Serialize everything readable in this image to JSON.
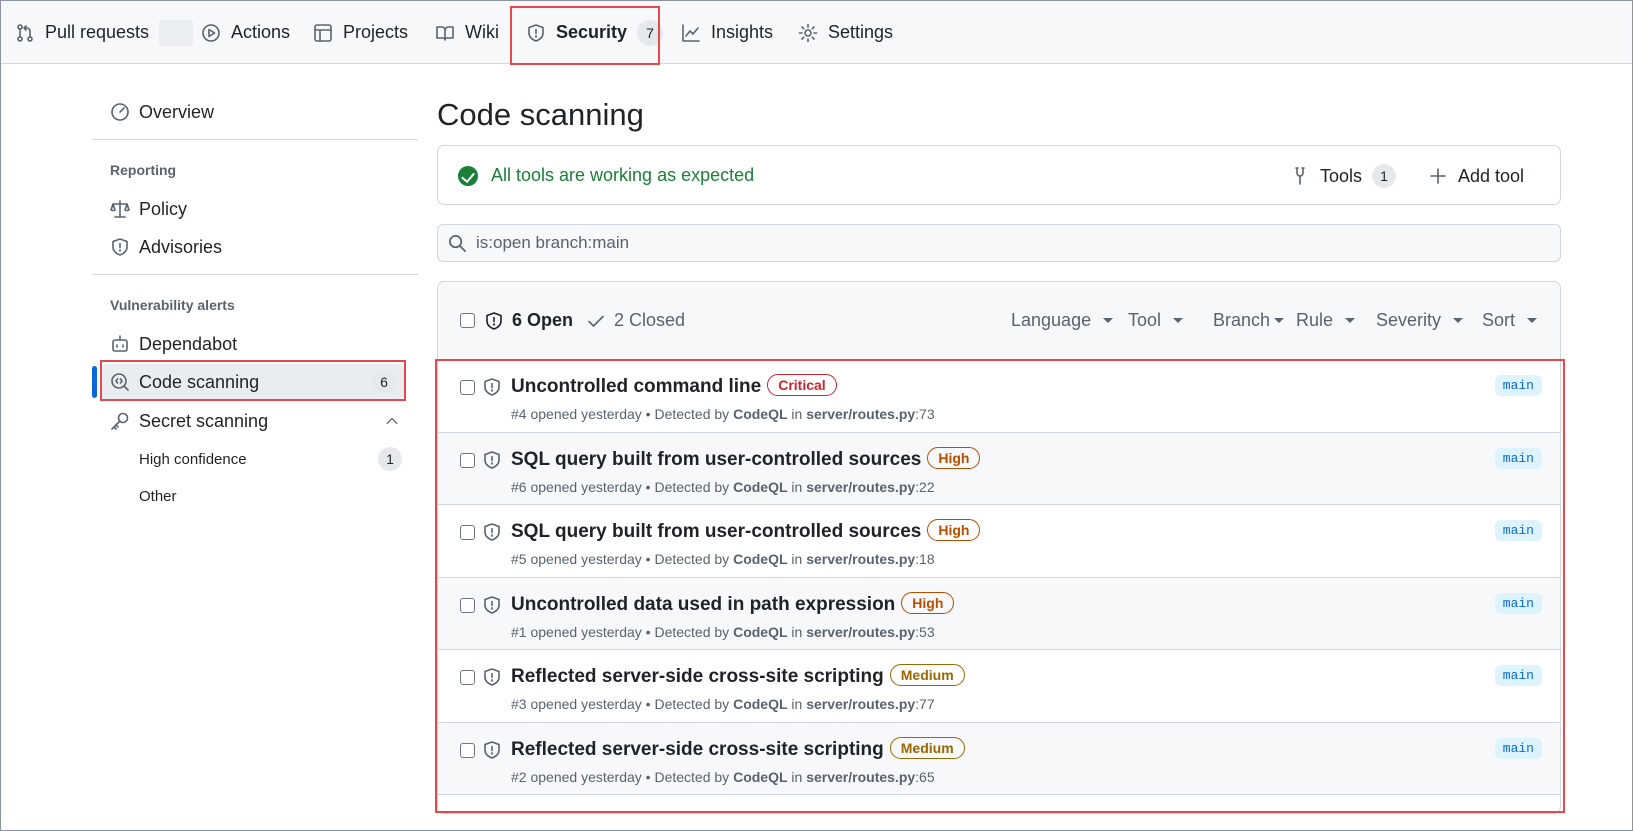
{
  "topnav": {
    "tabs": [
      {
        "label": "Pull requests",
        "icon": "git-pull-request-icon"
      },
      {
        "label": "Actions",
        "icon": "play-icon"
      },
      {
        "label": "Projects",
        "icon": "table-icon"
      },
      {
        "label": "Wiki",
        "icon": "book-icon"
      },
      {
        "label": "Security",
        "icon": "shield-icon",
        "count": "7",
        "selected": true
      },
      {
        "label": "Insights",
        "icon": "graph-icon"
      },
      {
        "label": "Settings",
        "icon": "gear-icon"
      }
    ]
  },
  "sidebar": {
    "overview": "Overview",
    "reporting_heading": "Reporting",
    "policy": "Policy",
    "advisories": "Advisories",
    "vuln_heading": "Vulnerability alerts",
    "dependabot": "Dependabot",
    "code_scanning": "Code scanning",
    "code_scanning_count": "6",
    "secret_scanning": "Secret scanning",
    "high_confidence": "High confidence",
    "high_confidence_count": "1",
    "other": "Other"
  },
  "main": {
    "title": "Code scanning",
    "status_text": "All tools are working as expected",
    "tools_label": "Tools",
    "tools_count": "1",
    "add_tool_label": "Add tool",
    "search_value": "is:open branch:main",
    "open_label": "6 Open",
    "closed_label": "2 Closed",
    "filters": [
      "Language",
      "Tool",
      "Branch",
      "Rule",
      "Severity",
      "Sort"
    ]
  },
  "alerts": [
    {
      "title": "Uncontrolled command line",
      "severity": "Critical",
      "sev_class": "critical",
      "number": "#4",
      "opened": "opened yesterday",
      "detected_by_label": "Detected by",
      "tool": "CodeQL",
      "in_label": "in",
      "path": "server/routes.py",
      "line": ":73",
      "branch": "main"
    },
    {
      "title": "SQL query built from user-controlled sources",
      "severity": "High",
      "sev_class": "high",
      "number": "#6",
      "opened": "opened yesterday",
      "detected_by_label": "Detected by",
      "tool": "CodeQL",
      "in_label": "in",
      "path": "server/routes.py",
      "line": ":22",
      "branch": "main"
    },
    {
      "title": "SQL query built from user-controlled sources",
      "severity": "High",
      "sev_class": "high",
      "number": "#5",
      "opened": "opened yesterday",
      "detected_by_label": "Detected by",
      "tool": "CodeQL",
      "in_label": "in",
      "path": "server/routes.py",
      "line": ":18",
      "branch": "main"
    },
    {
      "title": "Uncontrolled data used in path expression",
      "severity": "High",
      "sev_class": "high",
      "number": "#1",
      "opened": "opened yesterday",
      "detected_by_label": "Detected by",
      "tool": "CodeQL",
      "in_label": "in",
      "path": "server/routes.py",
      "line": ":53",
      "branch": "main"
    },
    {
      "title": "Reflected server-side cross-site scripting",
      "severity": "Medium",
      "sev_class": "medium",
      "number": "#3",
      "opened": "opened yesterday",
      "detected_by_label": "Detected by",
      "tool": "CodeQL",
      "in_label": "in",
      "path": "server/routes.py",
      "line": ":77",
      "branch": "main"
    },
    {
      "title": "Reflected server-side cross-site scripting",
      "severity": "Medium",
      "sev_class": "medium",
      "number": "#2",
      "opened": "opened yesterday",
      "detected_by_label": "Detected by",
      "tool": "CodeQL",
      "in_label": "in",
      "path": "server/routes.py",
      "line": ":65",
      "branch": "main"
    }
  ],
  "colors": {
    "highlight": "#e5484d",
    "success": "#1a7f37",
    "accent": "#0969da",
    "critical": "#cf222e",
    "high": "#bc4c00",
    "medium": "#9a6700"
  }
}
